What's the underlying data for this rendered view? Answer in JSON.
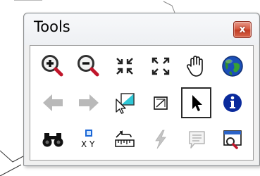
{
  "window": {
    "title": "Tools",
    "close_glyph": "x"
  },
  "tools": [
    {
      "name": "zoom-in-icon",
      "enabled": true
    },
    {
      "name": "zoom-out-icon",
      "enabled": true
    },
    {
      "name": "fixed-zoom-in-icon",
      "enabled": true
    },
    {
      "name": "fixed-zoom-out-icon",
      "enabled": true
    },
    {
      "name": "pan-hand-icon",
      "enabled": true
    },
    {
      "name": "full-extent-globe-icon",
      "enabled": true
    },
    {
      "name": "back-arrow-icon",
      "enabled": false
    },
    {
      "name": "forward-arrow-icon",
      "enabled": false
    },
    {
      "name": "select-features-icon",
      "enabled": true
    },
    {
      "name": "clear-selection-icon",
      "enabled": true
    },
    {
      "name": "select-elements-pointer-icon",
      "enabled": true,
      "selected": true
    },
    {
      "name": "identify-info-icon",
      "enabled": true
    },
    {
      "name": "find-binoculars-icon",
      "enabled": true
    },
    {
      "name": "go-to-xy-icon",
      "enabled": true
    },
    {
      "name": "measure-icon",
      "enabled": true
    },
    {
      "name": "hyperlink-lightning-icon",
      "enabled": false
    },
    {
      "name": "html-popup-icon",
      "enabled": false
    },
    {
      "name": "time-slider-window-icon",
      "enabled": true
    }
  ],
  "colors": {
    "selection_border": "#2a2a2a",
    "disabled_gray": "#b9b9b9",
    "info_blue": "#0a2a9c",
    "close_red": "#c8452b"
  }
}
